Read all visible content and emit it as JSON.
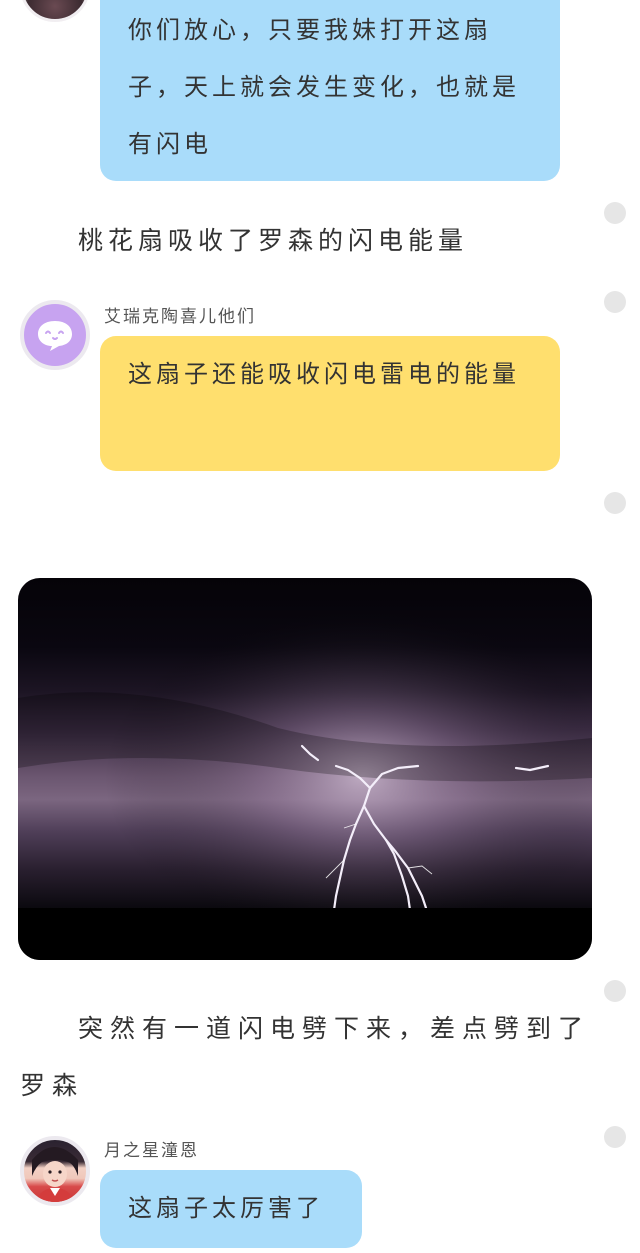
{
  "messages": [
    {
      "type": "bubble",
      "color": "blue",
      "text": "你们放心，只要我妹打开这扇子，天上就会发生变化，也就是有闪电"
    },
    {
      "type": "narration",
      "text": "桃花扇吸收了罗森的闪电能量"
    },
    {
      "type": "bubble",
      "color": "yellow",
      "sender": "艾瑞克陶喜儿他们",
      "text": "这扇子还能吸收闪电雷电的能量"
    },
    {
      "type": "image",
      "icon": "lightning-storm-photo"
    },
    {
      "type": "narration",
      "text": "突然有一道闪电劈下来，差点劈到了罗森"
    },
    {
      "type": "bubble",
      "color": "blue",
      "sender": "月之星潼恩",
      "text": "这扇子太厉害了"
    }
  ],
  "colors": {
    "bubble_blue": "#a9dcfa",
    "bubble_yellow": "#ffdf6e",
    "avatar_purple": "#c7a3f0",
    "dot_grey": "#e6e6e6"
  }
}
